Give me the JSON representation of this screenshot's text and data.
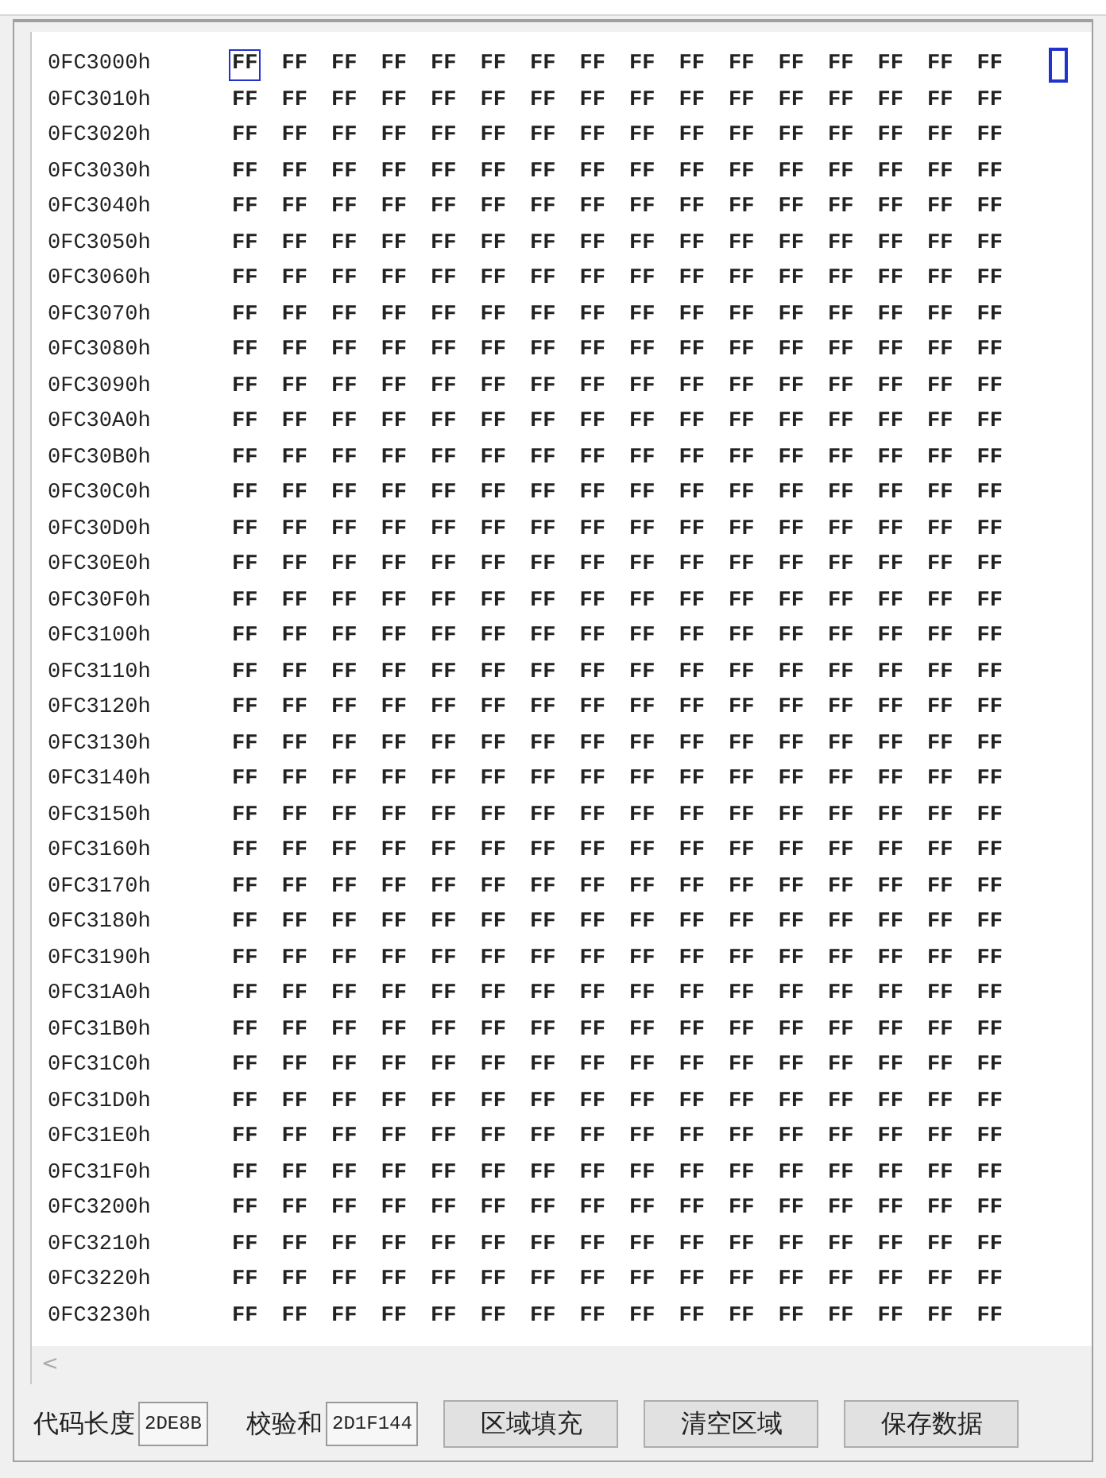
{
  "hex_view": {
    "rows": [
      {
        "address": "0FC3000h",
        "bytes": [
          {
            "text": "FF",
            "selected": true
          },
          {
            "text": "FF",
            "selected": false
          },
          {
            "text": "FF",
            "selected": false
          },
          {
            "text": "FF",
            "selected": false
          },
          {
            "text": "FF",
            "selected": false
          },
          {
            "text": "FF",
            "selected": false
          },
          {
            "text": "FF",
            "selected": false
          },
          {
            "text": "FF",
            "selected": false
          },
          {
            "text": "FF",
            "selected": false
          },
          {
            "text": "FF",
            "selected": false
          },
          {
            "text": "FF",
            "selected": false
          },
          {
            "text": "FF",
            "selected": false
          },
          {
            "text": "FF",
            "selected": false
          },
          {
            "text": "FF",
            "selected": false
          },
          {
            "text": "FF",
            "selected": false
          },
          {
            "text": "FF",
            "selected": false
          }
        ]
      },
      {
        "address": "0FC3010h",
        "bytes": [
          "FF",
          "FF",
          "FF",
          "FF",
          "FF",
          "FF",
          "FF",
          "FF",
          "FF",
          "FF",
          "FF",
          "FF",
          "FF",
          "FF",
          "FF",
          "FF"
        ]
      },
      {
        "address": "0FC3020h",
        "bytes": [
          "FF",
          "FF",
          "FF",
          "FF",
          "FF",
          "FF",
          "FF",
          "FF",
          "FF",
          "FF",
          "FF",
          "FF",
          "FF",
          "FF",
          "FF",
          "FF"
        ]
      },
      {
        "address": "0FC3030h",
        "bytes": [
          "FF",
          "FF",
          "FF",
          "FF",
          "FF",
          "FF",
          "FF",
          "FF",
          "FF",
          "FF",
          "FF",
          "FF",
          "FF",
          "FF",
          "FF",
          "FF"
        ]
      },
      {
        "address": "0FC3040h",
        "bytes": [
          "FF",
          "FF",
          "FF",
          "FF",
          "FF",
          "FF",
          "FF",
          "FF",
          "FF",
          "FF",
          "FF",
          "FF",
          "FF",
          "FF",
          "FF",
          "FF"
        ]
      },
      {
        "address": "0FC3050h",
        "bytes": [
          "FF",
          "FF",
          "FF",
          "FF",
          "FF",
          "FF",
          "FF",
          "FF",
          "FF",
          "FF",
          "FF",
          "FF",
          "FF",
          "FF",
          "FF",
          "FF"
        ]
      },
      {
        "address": "0FC3060h",
        "bytes": [
          "FF",
          "FF",
          "FF",
          "FF",
          "FF",
          "FF",
          "FF",
          "FF",
          "FF",
          "FF",
          "FF",
          "FF",
          "FF",
          "FF",
          "FF",
          "FF"
        ]
      },
      {
        "address": "0FC3070h",
        "bytes": [
          "FF",
          "FF",
          "FF",
          "FF",
          "FF",
          "FF",
          "FF",
          "FF",
          "FF",
          "FF",
          "FF",
          "FF",
          "FF",
          "FF",
          "FF",
          "FF"
        ]
      },
      {
        "address": "0FC3080h",
        "bytes": [
          "FF",
          "FF",
          "FF",
          "FF",
          "FF",
          "FF",
          "FF",
          "FF",
          "FF",
          "FF",
          "FF",
          "FF",
          "FF",
          "FF",
          "FF",
          "FF"
        ]
      },
      {
        "address": "0FC3090h",
        "bytes": [
          "FF",
          "FF",
          "FF",
          "FF",
          "FF",
          "FF",
          "FF",
          "FF",
          "FF",
          "FF",
          "FF",
          "FF",
          "FF",
          "FF",
          "FF",
          "FF"
        ]
      },
      {
        "address": "0FC30A0h",
        "bytes": [
          "FF",
          "FF",
          "FF",
          "FF",
          "FF",
          "FF",
          "FF",
          "FF",
          "FF",
          "FF",
          "FF",
          "FF",
          "FF",
          "FF",
          "FF",
          "FF"
        ]
      },
      {
        "address": "0FC30B0h",
        "bytes": [
          "FF",
          "FF",
          "FF",
          "FF",
          "FF",
          "FF",
          "FF",
          "FF",
          "FF",
          "FF",
          "FF",
          "FF",
          "FF",
          "FF",
          "FF",
          "FF"
        ]
      },
      {
        "address": "0FC30C0h",
        "bytes": [
          "FF",
          "FF",
          "FF",
          "FF",
          "FF",
          "FF",
          "FF",
          "FF",
          "FF",
          "FF",
          "FF",
          "FF",
          "FF",
          "FF",
          "FF",
          "FF"
        ]
      },
      {
        "address": "0FC30D0h",
        "bytes": [
          "FF",
          "FF",
          "FF",
          "FF",
          "FF",
          "FF",
          "FF",
          "FF",
          "FF",
          "FF",
          "FF",
          "FF",
          "FF",
          "FF",
          "FF",
          "FF"
        ]
      },
      {
        "address": "0FC30E0h",
        "bytes": [
          "FF",
          "FF",
          "FF",
          "FF",
          "FF",
          "FF",
          "FF",
          "FF",
          "FF",
          "FF",
          "FF",
          "FF",
          "FF",
          "FF",
          "FF",
          "FF"
        ]
      },
      {
        "address": "0FC30F0h",
        "bytes": [
          "FF",
          "FF",
          "FF",
          "FF",
          "FF",
          "FF",
          "FF",
          "FF",
          "FF",
          "FF",
          "FF",
          "FF",
          "FF",
          "FF",
          "FF",
          "FF"
        ]
      },
      {
        "address": "0FC3100h",
        "bytes": [
          "FF",
          "FF",
          "FF",
          "FF",
          "FF",
          "FF",
          "FF",
          "FF",
          "FF",
          "FF",
          "FF",
          "FF",
          "FF",
          "FF",
          "FF",
          "FF"
        ]
      },
      {
        "address": "0FC3110h",
        "bytes": [
          "FF",
          "FF",
          "FF",
          "FF",
          "FF",
          "FF",
          "FF",
          "FF",
          "FF",
          "FF",
          "FF",
          "FF",
          "FF",
          "FF",
          "FF",
          "FF"
        ]
      },
      {
        "address": "0FC3120h",
        "bytes": [
          "FF",
          "FF",
          "FF",
          "FF",
          "FF",
          "FF",
          "FF",
          "FF",
          "FF",
          "FF",
          "FF",
          "FF",
          "FF",
          "FF",
          "FF",
          "FF"
        ]
      },
      {
        "address": "0FC3130h",
        "bytes": [
          "FF",
          "FF",
          "FF",
          "FF",
          "FF",
          "FF",
          "FF",
          "FF",
          "FF",
          "FF",
          "FF",
          "FF",
          "FF",
          "FF",
          "FF",
          "FF"
        ]
      },
      {
        "address": "0FC3140h",
        "bytes": [
          "FF",
          "FF",
          "FF",
          "FF",
          "FF",
          "FF",
          "FF",
          "FF",
          "FF",
          "FF",
          "FF",
          "FF",
          "FF",
          "FF",
          "FF",
          "FF"
        ]
      },
      {
        "address": "0FC3150h",
        "bytes": [
          "FF",
          "FF",
          "FF",
          "FF",
          "FF",
          "FF",
          "FF",
          "FF",
          "FF",
          "FF",
          "FF",
          "FF",
          "FF",
          "FF",
          "FF",
          "FF"
        ]
      },
      {
        "address": "0FC3160h",
        "bytes": [
          "FF",
          "FF",
          "FF",
          "FF",
          "FF",
          "FF",
          "FF",
          "FF",
          "FF",
          "FF",
          "FF",
          "FF",
          "FF",
          "FF",
          "FF",
          "FF"
        ]
      },
      {
        "address": "0FC3170h",
        "bytes": [
          "FF",
          "FF",
          "FF",
          "FF",
          "FF",
          "FF",
          "FF",
          "FF",
          "FF",
          "FF",
          "FF",
          "FF",
          "FF",
          "FF",
          "FF",
          "FF"
        ]
      },
      {
        "address": "0FC3180h",
        "bytes": [
          "FF",
          "FF",
          "FF",
          "FF",
          "FF",
          "FF",
          "FF",
          "FF",
          "FF",
          "FF",
          "FF",
          "FF",
          "FF",
          "FF",
          "FF",
          "FF"
        ]
      },
      {
        "address": "0FC3190h",
        "bytes": [
          "FF",
          "FF",
          "FF",
          "FF",
          "FF",
          "FF",
          "FF",
          "FF",
          "FF",
          "FF",
          "FF",
          "FF",
          "FF",
          "FF",
          "FF",
          "FF"
        ]
      },
      {
        "address": "0FC31A0h",
        "bytes": [
          "FF",
          "FF",
          "FF",
          "FF",
          "FF",
          "FF",
          "FF",
          "FF",
          "FF",
          "FF",
          "FF",
          "FF",
          "FF",
          "FF",
          "FF",
          "FF"
        ]
      },
      {
        "address": "0FC31B0h",
        "bytes": [
          "FF",
          "FF",
          "FF",
          "FF",
          "FF",
          "FF",
          "FF",
          "FF",
          "FF",
          "FF",
          "FF",
          "FF",
          "FF",
          "FF",
          "FF",
          "FF"
        ]
      },
      {
        "address": "0FC31C0h",
        "bytes": [
          "FF",
          "FF",
          "FF",
          "FF",
          "FF",
          "FF",
          "FF",
          "FF",
          "FF",
          "FF",
          "FF",
          "FF",
          "FF",
          "FF",
          "FF",
          "FF"
        ]
      },
      {
        "address": "0FC31D0h",
        "bytes": [
          "FF",
          "FF",
          "FF",
          "FF",
          "FF",
          "FF",
          "FF",
          "FF",
          "FF",
          "FF",
          "FF",
          "FF",
          "FF",
          "FF",
          "FF",
          "FF"
        ]
      },
      {
        "address": "0FC31E0h",
        "bytes": [
          "FF",
          "FF",
          "FF",
          "FF",
          "FF",
          "FF",
          "FF",
          "FF",
          "FF",
          "FF",
          "FF",
          "FF",
          "FF",
          "FF",
          "FF",
          "FF"
        ]
      },
      {
        "address": "0FC31F0h",
        "bytes": [
          "FF",
          "FF",
          "FF",
          "FF",
          "FF",
          "FF",
          "FF",
          "FF",
          "FF",
          "FF",
          "FF",
          "FF",
          "FF",
          "FF",
          "FF",
          "FF"
        ]
      },
      {
        "address": "0FC3200h",
        "bytes": [
          "FF",
          "FF",
          "FF",
          "FF",
          "FF",
          "FF",
          "FF",
          "FF",
          "FF",
          "FF",
          "FF",
          "FF",
          "FF",
          "FF",
          "FF",
          "FF"
        ]
      },
      {
        "address": "0FC3210h",
        "bytes": [
          "FF",
          "FF",
          "FF",
          "FF",
          "FF",
          "FF",
          "FF",
          "FF",
          "FF",
          "FF",
          "FF",
          "FF",
          "FF",
          "FF",
          "FF",
          "FF"
        ]
      },
      {
        "address": "0FC3220h",
        "bytes": [
          "FF",
          "FF",
          "FF",
          "FF",
          "FF",
          "FF",
          "FF",
          "FF",
          "FF",
          "FF",
          "FF",
          "FF",
          "FF",
          "FF",
          "FF",
          "FF"
        ]
      },
      {
        "address": "0FC3230h",
        "bytes": [
          "FF",
          "FF",
          "FF",
          "FF",
          "FF",
          "FF",
          "FF",
          "FF",
          "FF",
          "FF",
          "FF",
          "FF",
          "FF",
          "FF",
          "FF",
          "FF"
        ]
      }
    ]
  },
  "scrollbar": {
    "left_arrow": "<"
  },
  "footer": {
    "code_length_label": "代码长度",
    "code_length": "2DE8B",
    "checksum_label": "校验和",
    "checksum": "2D1F144",
    "buttons": [
      "区域填充",
      "清空区域",
      "保存数据"
    ]
  }
}
